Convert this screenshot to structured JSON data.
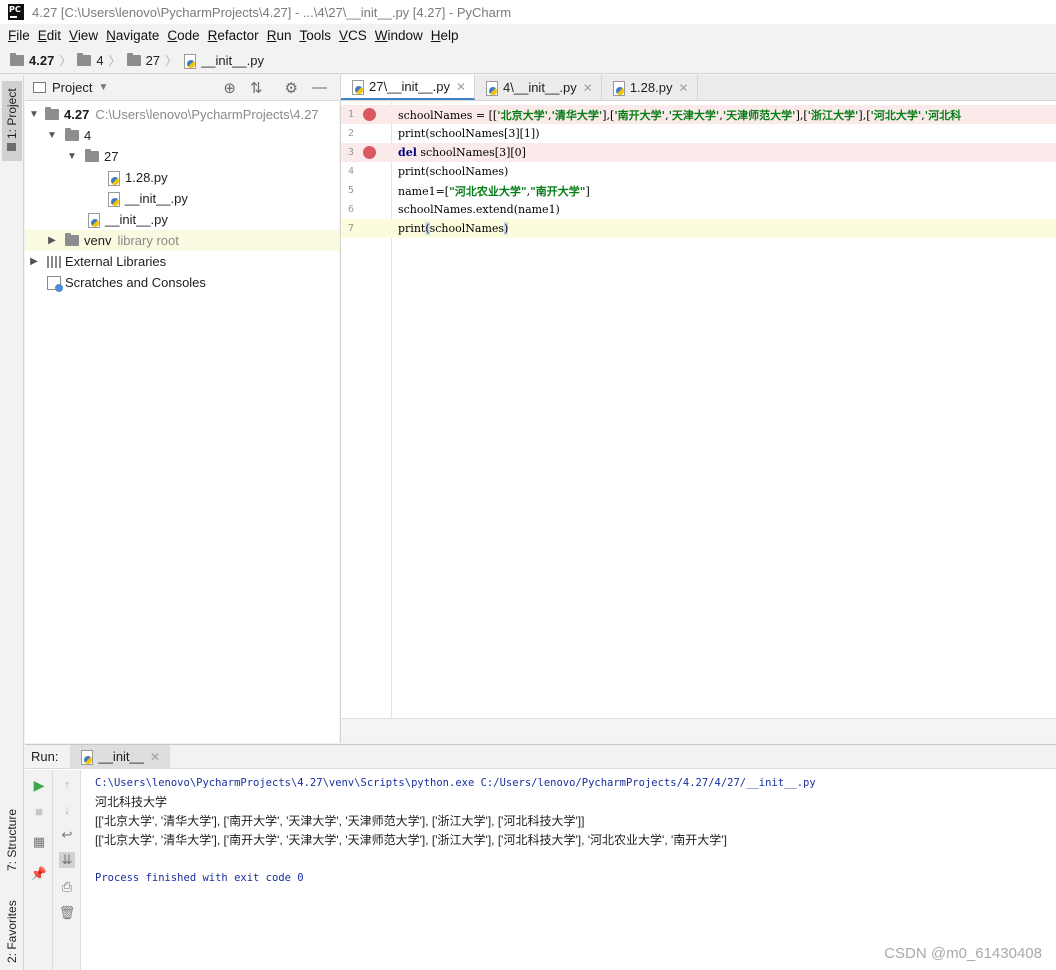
{
  "window": {
    "title": "4.27 [C:\\Users\\lenovo\\PycharmProjects\\4.27] - ...\\4\\27\\__init__.py [4.27] - PyCharm",
    "logo": "PC"
  },
  "menu": [
    "File",
    "Edit",
    "View",
    "Navigate",
    "Code",
    "Refactor",
    "Run",
    "Tools",
    "VCS",
    "Window",
    "Help"
  ],
  "breadcrumb": [
    "4.27",
    "4",
    "27",
    "__init__.py"
  ],
  "left_stripe": {
    "project_tab": "1: Project",
    "structure_tab": "7: Structure",
    "favorites_tab": "2: Favorites"
  },
  "project_panel": {
    "title": "Project",
    "tree": {
      "root_name": "4.27",
      "root_path": "C:\\Users\\lenovo\\PycharmProjects\\4.27",
      "folder_4": "4",
      "folder_27": "27",
      "file_128": "1.28.py",
      "file_init_27": "__init__.py",
      "file_init_4": "__init__.py",
      "venv": "venv",
      "venv_hint": "library root",
      "external_libraries": "External Libraries",
      "scratches": "Scratches and Consoles"
    }
  },
  "editor": {
    "tabs": [
      {
        "label": "27\\__init__.py"
      },
      {
        "label": "4\\__init__.py"
      },
      {
        "label": "1.28.py"
      }
    ],
    "lines": [
      {
        "num": "1"
      },
      {
        "num": "2",
        "text": "print(schoolNames[3][1])"
      },
      {
        "num": "3"
      },
      {
        "num": "4",
        "text": "print(schoolNames)"
      },
      {
        "num": "5"
      },
      {
        "num": "6",
        "text": "schoolNames.extend(name1)"
      },
      {
        "num": "7"
      }
    ],
    "line1": {
      "prefix": "schoolNames = [[",
      "s1": "'北京大学'",
      "c1": ",",
      "s2": "'清华大学'",
      "c2": "],[",
      "s3": "'南开大学'",
      "c3": ",",
      "s4": "'天津大学'",
      "c4": ",",
      "s5": "'天津师范大学'",
      "c5": "],[",
      "s6": "'浙江大学'",
      "c6": "],[",
      "s7": "'河北大学'",
      "c7": ",",
      "s8": "'河北科"
    },
    "line3": {
      "kw": "del",
      "rest": " schoolNames[3][0]"
    },
    "line5": {
      "prefix": "name1=[",
      "s1": "\"河北农业大学\"",
      "c1": ",",
      "s2": "\"南开大学\"",
      "suffix": "]"
    },
    "line7": {
      "prefix": "print",
      "paren_open": "(",
      "arg": "schoolNames",
      "paren_close": ")"
    }
  },
  "run_panel": {
    "label": "Run:",
    "tab": "__init__",
    "console": [
      "C:\\Users\\lenovo\\PycharmProjects\\4.27\\venv\\Scripts\\python.exe C:/Users/lenovo/PycharmProjects/4.27/4/27/__init__.py",
      "河北科技大学",
      "[['北京大学', '清华大学'], ['南开大学', '天津大学', '天津师范大学'], ['浙江大学'], ['河北科技大学']]",
      "[['北京大学', '清华大学'], ['南开大学', '天津大学', '天津师范大学'], ['浙江大学'], ['河北科技大学'], '河北农业大学', '南开大学']",
      "",
      "Process finished with exit code 0"
    ]
  },
  "watermark": "CSDN @m0_61430408",
  "colors": {
    "breakpoint": "#db5860",
    "accent": "#4083c9",
    "keyword": "#000080",
    "string": "#067d17"
  }
}
